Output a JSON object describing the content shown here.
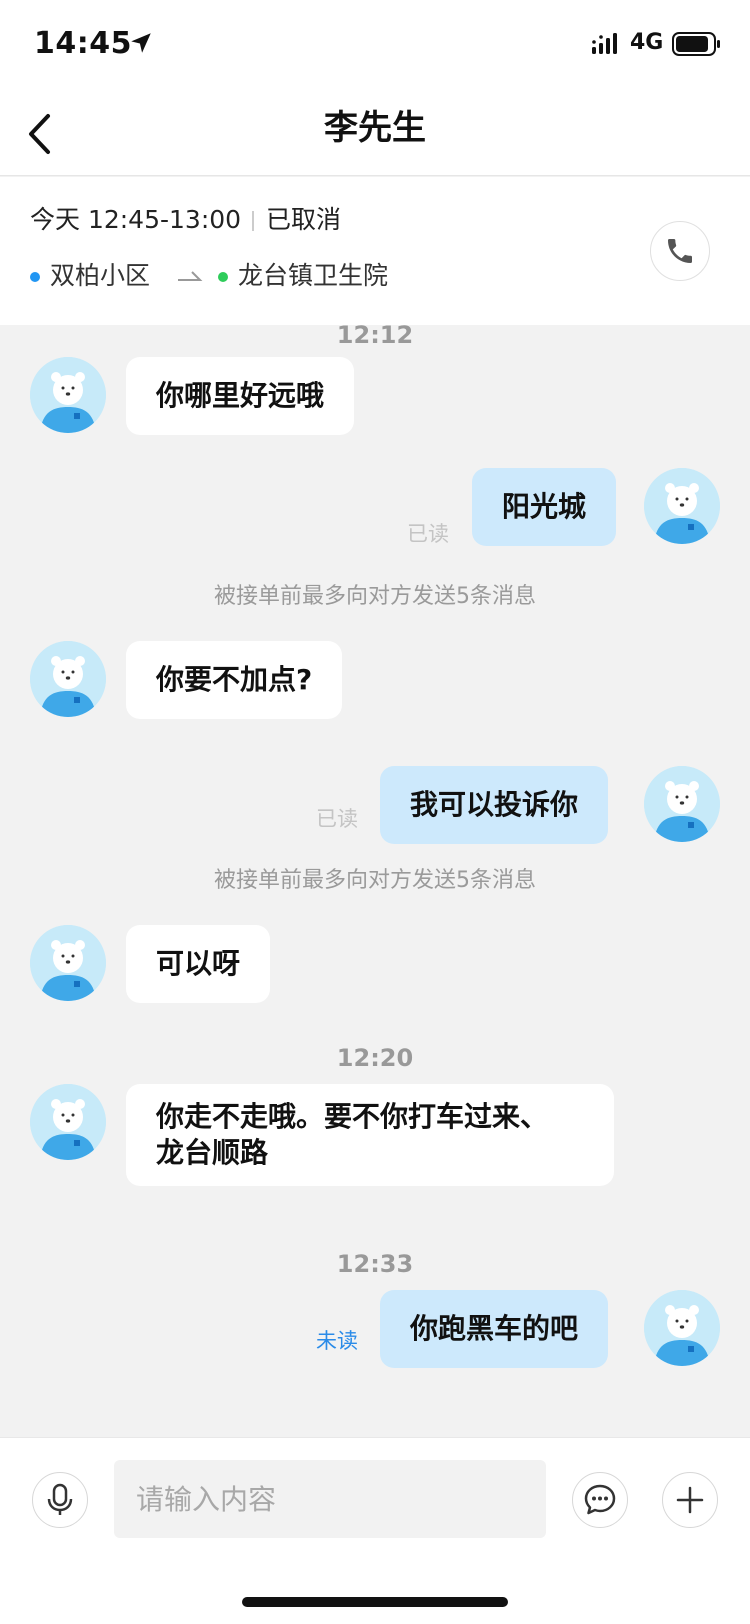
{
  "status_bar": {
    "time": "14:45",
    "network": "4G",
    "location_icon": "location-arrow-icon",
    "signal_icon": "signal-icon",
    "battery_icon": "battery-icon"
  },
  "nav": {
    "title": "李先生",
    "back_icon": "chevron-left-icon"
  },
  "order": {
    "time": "今天 12:45-13:00",
    "status": "已取消",
    "from": "双柏小区",
    "to": "龙台镇卫生院",
    "from_dot_color": "#2196f3",
    "to_dot_color": "#2ecc5a",
    "phone_icon": "phone-icon"
  },
  "chat": {
    "messages": [
      {
        "type": "timestamp",
        "text": "12:12"
      },
      {
        "type": "incoming",
        "text": "你哪里好远哦"
      },
      {
        "type": "outgoing",
        "text": "阳光城",
        "read_status": "已读"
      },
      {
        "type": "notice",
        "text": "被接单前最多向对方发送5条消息"
      },
      {
        "type": "incoming",
        "text": "你要不加点?"
      },
      {
        "type": "outgoing",
        "text": "我可以投诉你",
        "read_status": "已读"
      },
      {
        "type": "notice",
        "text": "被接单前最多向对方发送5条消息"
      },
      {
        "type": "incoming",
        "text": "可以呀"
      },
      {
        "type": "timestamp",
        "text": "12:20"
      },
      {
        "type": "incoming",
        "text_line1": "你走不走哦。要不你打车过来、",
        "text_line2": "龙台顺路"
      },
      {
        "type": "timestamp",
        "text": "12:33"
      },
      {
        "type": "outgoing",
        "text": "你跑黑车的吧",
        "read_status": "未读"
      }
    ]
  },
  "input_bar": {
    "placeholder": "请输入内容",
    "voice_icon": "microphone-icon",
    "quick_reply_icon": "chat-bubble-icon",
    "add_icon": "plus-icon"
  },
  "colors": {
    "outgoing_bubble": "#cde9fc",
    "incoming_bubble": "#ffffff",
    "unread": "#2a8be8",
    "background": "#f2f2f2"
  }
}
